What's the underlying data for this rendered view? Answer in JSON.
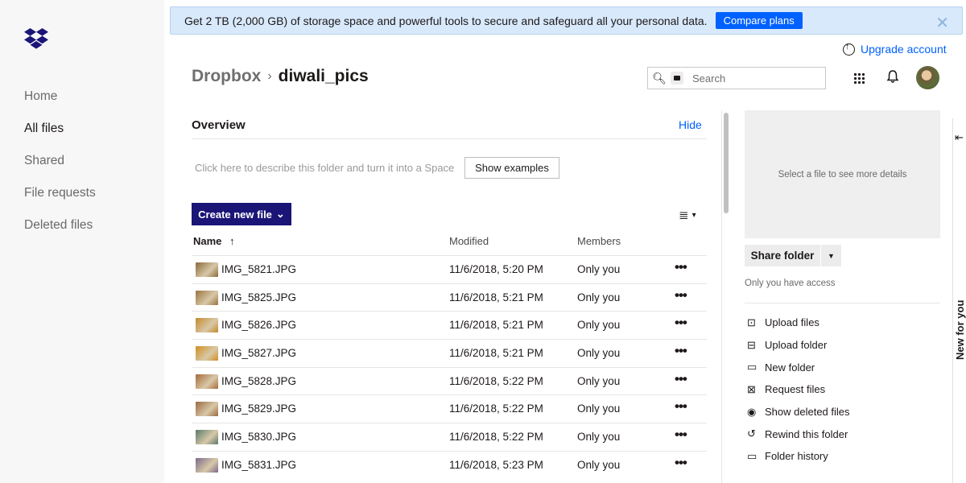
{
  "sidebar": {
    "items": [
      {
        "label": "Home",
        "active": false
      },
      {
        "label": "All files",
        "active": true
      },
      {
        "label": "Shared",
        "active": false
      },
      {
        "label": "File requests",
        "active": false
      },
      {
        "label": "Deleted files",
        "active": false
      }
    ]
  },
  "banner": {
    "text": "Get 2 TB (2,000 GB) of storage space and powerful tools to secure and safeguard all your personal data.",
    "button": "Compare plans",
    "close": "✕"
  },
  "header": {
    "upgrade": "Upgrade account",
    "breadcrumb_root": "Dropbox",
    "breadcrumb_sep": "›",
    "breadcrumb_current": "diwali_pics",
    "search_placeholder": "Search"
  },
  "overview": {
    "title": "Overview",
    "hide": "Hide",
    "description": "Click here to describe this folder and turn it into a Space",
    "show_examples": "Show examples"
  },
  "toolbar": {
    "create_label": "Create new file",
    "create_caret": "⌄"
  },
  "table": {
    "columns": {
      "name": "Name",
      "sort_arrow": "↑",
      "modified": "Modified",
      "members": "Members"
    },
    "rows": [
      {
        "name": "IMG_5821.JPG",
        "modified": "11/6/2018, 5:20 PM",
        "members": "Only you",
        "thumb": "#8a6a3a"
      },
      {
        "name": "IMG_5825.JPG",
        "modified": "11/6/2018, 5:21 PM",
        "members": "Only you",
        "thumb": "#9a7440"
      },
      {
        "name": "IMG_5826.JPG",
        "modified": "11/6/2018, 5:21 PM",
        "members": "Only you",
        "thumb": "#c48a2a"
      },
      {
        "name": "IMG_5827.JPG",
        "modified": "11/6/2018, 5:21 PM",
        "members": "Only you",
        "thumb": "#d09020"
      },
      {
        "name": "IMG_5828.JPG",
        "modified": "11/6/2018, 5:22 PM",
        "members": "Only you",
        "thumb": "#a86a3a"
      },
      {
        "name": "IMG_5829.JPG",
        "modified": "11/6/2018, 5:22 PM",
        "members": "Only you",
        "thumb": "#9a6a40"
      },
      {
        "name": "IMG_5830.JPG",
        "modified": "11/6/2018, 5:22 PM",
        "members": "Only you",
        "thumb": "#5a7a6a"
      },
      {
        "name": "IMG_5831.JPG",
        "modified": "11/6/2018, 5:23 PM",
        "members": "Only you",
        "thumb": "#7a6a8a"
      }
    ],
    "more": "•••"
  },
  "right_panel": {
    "preview_text": "Select a file to see more details",
    "share_label": "Share folder",
    "share_caret": "▼",
    "access_text": "Only you have access",
    "actions": [
      {
        "label": "Upload files",
        "icon": "upload-file-icon",
        "glyph": "⊡"
      },
      {
        "label": "Upload folder",
        "icon": "upload-folder-icon",
        "glyph": "⊟"
      },
      {
        "label": "New folder",
        "icon": "folder-icon",
        "glyph": "▭"
      },
      {
        "label": "Request files",
        "icon": "request-files-icon",
        "glyph": "⊠"
      },
      {
        "label": "Show deleted files",
        "icon": "eye-icon",
        "glyph": "◉"
      },
      {
        "label": "Rewind this folder",
        "icon": "rewind-icon",
        "glyph": "↺"
      },
      {
        "label": "Folder history",
        "icon": "folder-history-icon",
        "glyph": "▭"
      }
    ]
  },
  "new_for_you": {
    "label": "New for you",
    "arrow": "⇤"
  },
  "colors": {
    "accent": "#0061fe",
    "create_button": "#1a1577",
    "sidebar_bg": "#f7f7f7",
    "banner_bg": "#d8e9fc"
  }
}
